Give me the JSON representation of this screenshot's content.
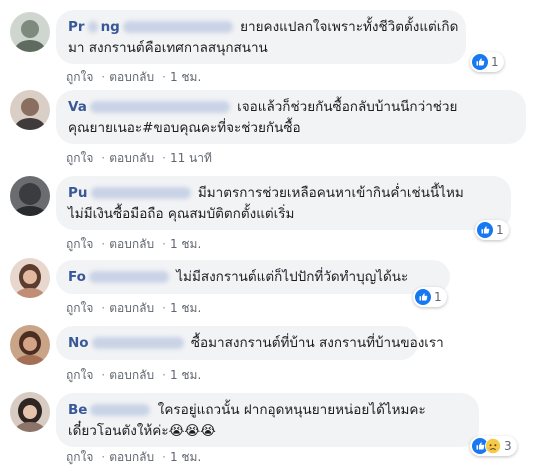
{
  "comments": [
    {
      "author_visible_start": "Pr",
      "author_visible_mid": "ng",
      "text_lines": [
        "ยายคงแปลกใจเพราะทั้งชีวิตตั้งแต่เกิด",
        "มา สงกรานต์คือเทศกาลสนุกสนาน"
      ],
      "actions": {
        "like": "ถูกใจ",
        "reply": "ตอบกลับ",
        "time": "1 ชม."
      },
      "reaction_count": "1",
      "reactions": [
        "like-icon"
      ]
    },
    {
      "author_visible_start": "Va",
      "author_visible_mid": "",
      "text_lines": [
        "เจอแล้วก็ช่วยกันซื้อกลับบ้านนีกว่าช่วย",
        "คุณยายเนอะ#ขอบคุณคะที่จะช่วยกันซื้อ"
      ],
      "actions": {
        "like": "ถูกใจ",
        "reply": "ตอบกลับ",
        "time": "11 นาที"
      },
      "reaction_count": "",
      "reactions": []
    },
    {
      "author_visible_start": "Pu",
      "author_visible_mid": "",
      "text_lines": [
        "มีมาตรการช่วยเหลือคนหาเข้ากินค่ำเช่นนี้ไหม",
        "ไม่มีเงินซื้อมือถือ คุณสมบัติตกตั้งแต่เริ่ม"
      ],
      "actions": {
        "like": "ถูกใจ",
        "reply": "ตอบกลับ",
        "time": "1 ชม."
      },
      "reaction_count": "1",
      "reactions": [
        "like-icon"
      ]
    },
    {
      "author_visible_start": "Fo",
      "author_visible_mid": "",
      "text_lines": [
        "ไม่มีสงกรานต์แต่ก็ไปปักที่วัดทำบุญได้นะ"
      ],
      "actions": {
        "like": "ถูกใจ",
        "reply": "ตอบกลับ",
        "time": "1 ชม."
      },
      "reaction_count": "1",
      "reactions": [
        "like-icon"
      ]
    },
    {
      "author_visible_start": "No",
      "author_visible_mid": "",
      "text_lines": [
        "ซื้อมาสงกรานต์ที่บ้าน สงกรานที่บ้านของเรา"
      ],
      "actions": {
        "like": "ถูกใจ",
        "reply": "ตอบกลับ",
        "time": "1 ชม."
      },
      "reaction_count": "",
      "reactions": []
    },
    {
      "author_visible_start": "Be",
      "author_visible_mid": "",
      "text_lines": [
        "ใครอยู่แถวนั้น ฝากอุดหนุนยายหน่อยได้ไหมคะ",
        "เดี๋ยวโอนตังให้ค่ะ😭😭😭"
      ],
      "actions": {
        "like": "ถูกใจ",
        "reply": "ตอบกลับ",
        "time": "1 ชม."
      },
      "reaction_count": "3",
      "reactions": [
        "like-icon",
        "sad-icon"
      ]
    }
  ],
  "colors": {
    "author": "#385898",
    "bubble": "#f2f3f5",
    "like_blue": "#1877f2",
    "meta": "#616770"
  }
}
